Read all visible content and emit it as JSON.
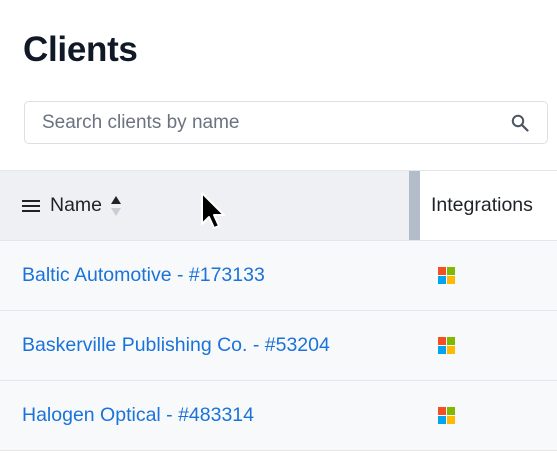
{
  "page": {
    "title": "Clients"
  },
  "search": {
    "placeholder": "Search clients by name",
    "value": "",
    "icon": "search-icon"
  },
  "table": {
    "columns": [
      {
        "label": "Name",
        "menu_icon": "menu-icon",
        "sort": "ascending"
      },
      {
        "label": "Integrations"
      }
    ],
    "rows": [
      {
        "name": "Baltic Automotive - #173133",
        "integration_icon": "microsoft-icon"
      },
      {
        "name": "Baskerville Publishing Co. - #53204",
        "integration_icon": "microsoft-icon"
      },
      {
        "name": "Halogen Optical - #483314",
        "integration_icon": "microsoft-icon"
      }
    ]
  },
  "colors": {
    "link": "#1a73d9",
    "header_bg": "#eef0f3",
    "row_bg": "#f8f9fb",
    "resize_handle": "#b3bcc9",
    "microsoft_red": "#f25022",
    "microsoft_green": "#7fba00",
    "microsoft_blue": "#00a4ef",
    "microsoft_yellow": "#ffb900"
  }
}
